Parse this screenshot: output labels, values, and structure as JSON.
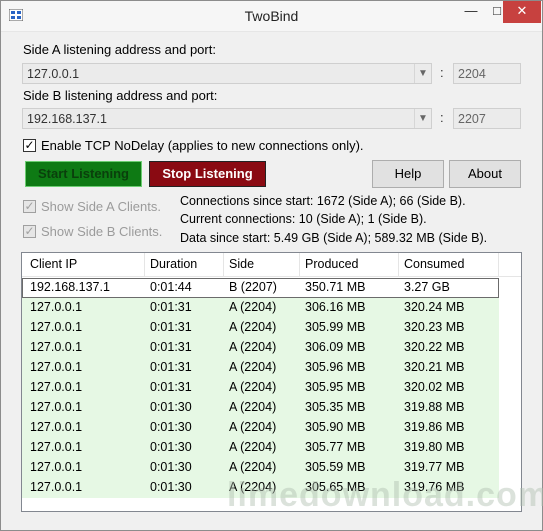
{
  "window": {
    "title": "TwoBind",
    "min": "—",
    "max": "□",
    "close": "✕"
  },
  "sideA": {
    "label": "Side A listening address and port:",
    "address": "127.0.0.1",
    "port": "2204"
  },
  "sideB": {
    "label": "Side B listening address and port:",
    "address": "192.168.137.1",
    "port": "2207"
  },
  "colon": ":",
  "nodelay": {
    "label": "Enable TCP NoDelay (applies to new connections only).",
    "checked": true
  },
  "buttons": {
    "start": "Start Listening",
    "stop": "Stop Listening",
    "help": "Help",
    "about": "About"
  },
  "options": {
    "showA": "Show Side A Clients.",
    "showB": "Show Side B Clients."
  },
  "stats": {
    "connections": "Connections since start: 1672 (Side A); 66 (Side B).",
    "current": "Current connections: 10 (Side A); 1 (Side B).",
    "data": "Data since start: 5.49 GB (Side A); 589.32 MB (Side B)."
  },
  "table": {
    "headers": [
      "Client IP",
      "Duration",
      "Side",
      "Produced",
      "Consumed"
    ],
    "rows": [
      [
        "192.168.137.1",
        "0:01:44",
        "B (2207)",
        "350.71 MB",
        "3.27 GB"
      ],
      [
        "127.0.0.1",
        "0:01:31",
        "A (2204)",
        "306.16 MB",
        "320.24 MB"
      ],
      [
        "127.0.0.1",
        "0:01:31",
        "A (2204)",
        "305.99 MB",
        "320.23 MB"
      ],
      [
        "127.0.0.1",
        "0:01:31",
        "A (2204)",
        "306.09 MB",
        "320.22 MB"
      ],
      [
        "127.0.0.1",
        "0:01:31",
        "A (2204)",
        "305.96 MB",
        "320.21 MB"
      ],
      [
        "127.0.0.1",
        "0:01:31",
        "A (2204)",
        "305.95 MB",
        "320.02 MB"
      ],
      [
        "127.0.0.1",
        "0:01:30",
        "A (2204)",
        "305.35 MB",
        "319.88 MB"
      ],
      [
        "127.0.0.1",
        "0:01:30",
        "A (2204)",
        "305.90 MB",
        "319.86 MB"
      ],
      [
        "127.0.0.1",
        "0:01:30",
        "A (2204)",
        "305.77 MB",
        "319.80 MB"
      ],
      [
        "127.0.0.1",
        "0:01:30",
        "A (2204)",
        "305.59 MB",
        "319.77 MB"
      ],
      [
        "127.0.0.1",
        "0:01:30",
        "A (2204)",
        "305.65 MB",
        "319.76 MB"
      ]
    ]
  },
  "watermark": "limedownload.com",
  "colors": {
    "start_bg": "#0e7a14",
    "stop_bg": "#8a0a12",
    "row_bg": "#e6f8e4",
    "close_bg": "#c7413f"
  }
}
